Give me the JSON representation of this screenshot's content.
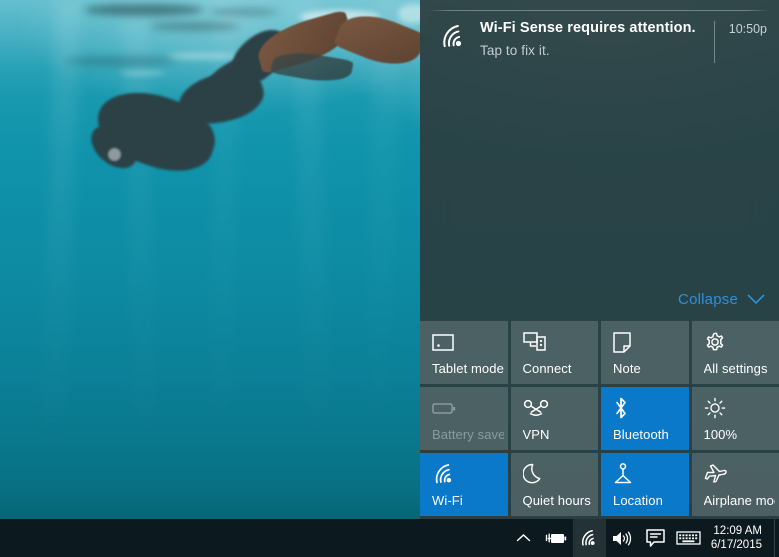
{
  "desktop": {
    "wallpaper_alt": "Underwater freediver with mermaid tail",
    "wallpaper_colors": {
      "top": "#2ba6b8",
      "mid": "#0d8ba3",
      "bottom": "#086676"
    }
  },
  "action_center": {
    "background": "#2b3d40",
    "accent": "#0a79c9",
    "notification": {
      "icon": "wifi-sense-icon",
      "title": "Wi-Fi Sense requires attention.",
      "subtitle": "Tap to fix it.",
      "time": "10:50p"
    },
    "collapse": {
      "label": "Collapse",
      "icon": "chevron-down-icon"
    },
    "tiles": [
      {
        "label": "Tablet mode",
        "icon": "tablet-icon",
        "state": "off"
      },
      {
        "label": "Connect",
        "icon": "connect-icon",
        "state": "off"
      },
      {
        "label": "Note",
        "icon": "note-icon",
        "state": "off"
      },
      {
        "label": "All settings",
        "icon": "gear-icon",
        "state": "off"
      },
      {
        "label": "Battery saver",
        "icon": "battery-icon",
        "state": "disabled"
      },
      {
        "label": "VPN",
        "icon": "vpn-icon",
        "state": "off"
      },
      {
        "label": "Bluetooth",
        "icon": "bluetooth-icon",
        "state": "on"
      },
      {
        "label": "100%",
        "icon": "brightness-icon",
        "state": "off"
      },
      {
        "label": "Wi-Fi",
        "icon": "wifi-icon",
        "state": "on"
      },
      {
        "label": "Quiet hours",
        "icon": "moon-icon",
        "state": "off"
      },
      {
        "label": "Location",
        "icon": "location-icon",
        "state": "on"
      },
      {
        "label": "Airplane mode",
        "icon": "airplane-icon",
        "state": "off"
      }
    ]
  },
  "taskbar": {
    "background": "#0c1a1f",
    "tray": [
      {
        "name": "show-hidden-icons",
        "icon": "chevron-up-icon"
      },
      {
        "name": "battery",
        "icon": "battery-charging-icon"
      },
      {
        "name": "network",
        "icon": "wifi-icon"
      },
      {
        "name": "volume",
        "icon": "speaker-icon"
      },
      {
        "name": "action-center",
        "icon": "action-center-icon"
      },
      {
        "name": "touch-keyboard",
        "icon": "keyboard-icon"
      }
    ],
    "clock": {
      "time": "12:09 AM",
      "date": "6/17/2015"
    }
  }
}
